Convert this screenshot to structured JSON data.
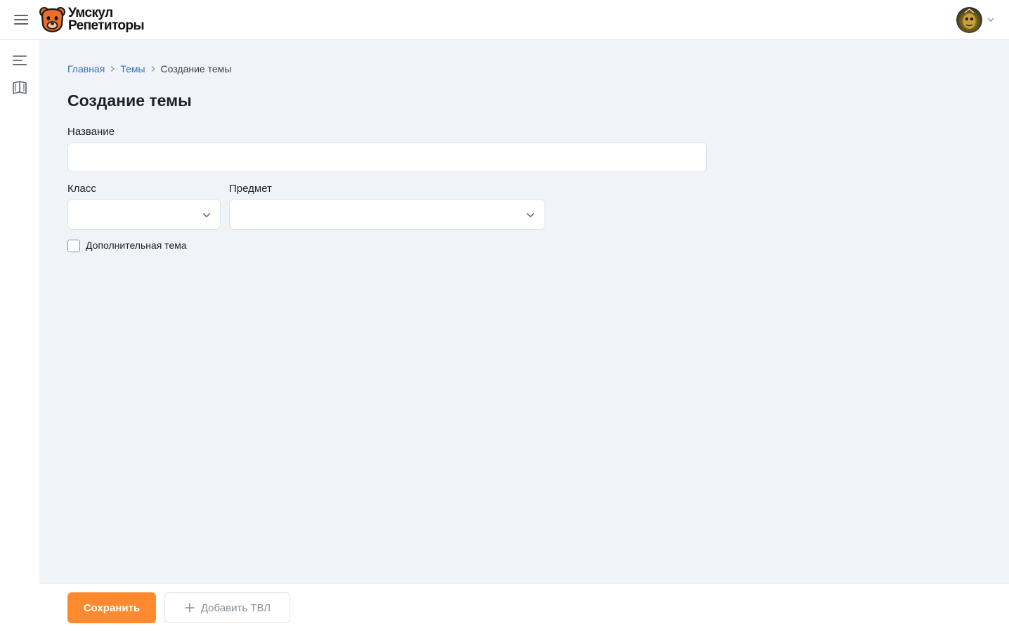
{
  "header": {
    "logo_line1": "Умскул",
    "logo_line2": "Репетиторы"
  },
  "breadcrumb": {
    "items": [
      "Главная",
      "Темы"
    ],
    "current": "Создание темы"
  },
  "page": {
    "title": "Создание темы"
  },
  "form": {
    "name": {
      "label": "Название",
      "value": ""
    },
    "grade": {
      "label": "Класс",
      "value": ""
    },
    "subject": {
      "label": "Предмет",
      "value": ""
    },
    "extra_topic": {
      "label": "Дополнительная тема",
      "checked": false
    }
  },
  "footer": {
    "save_label": "Сохранить",
    "add_label": "Добавить ТВЛ"
  },
  "colors": {
    "accent": "#fd8a2e",
    "link": "#3a6fb5",
    "background": "#f0f4f8"
  },
  "icons": {
    "menu": "hamburger-icon",
    "sidebar_list": "list-icon",
    "sidebar_book": "book-icon",
    "logo": "bear-logo-icon",
    "chevron": "chevron-down-icon",
    "plus": "plus-icon"
  }
}
